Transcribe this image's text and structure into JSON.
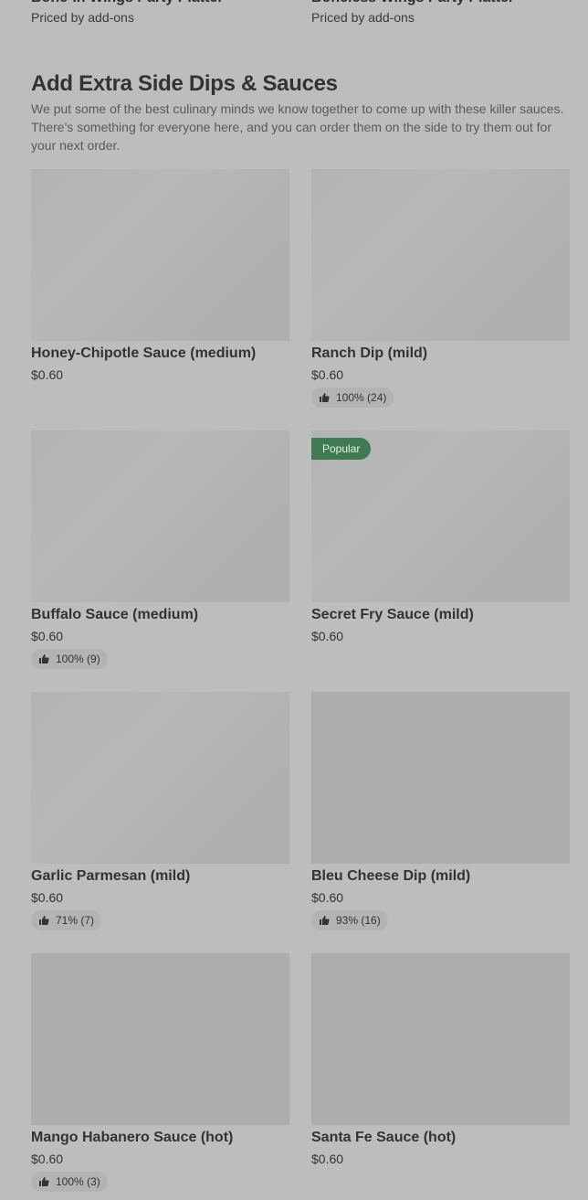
{
  "top_cards": [
    {
      "name": "Bone-In Wings Party Platter",
      "price_note": "Priced by add-ons"
    },
    {
      "name": "Boneless Wings Party Platter",
      "price_note": "Priced by add-ons"
    }
  ],
  "section": {
    "title": "Add Extra Side Dips & Sauces",
    "description": "We put some of the best culinary minds we know together to come up with these killer sauces. There's something for everyone here, and you can order them on the side to try them out for your next order."
  },
  "items": [
    {
      "title": "Honey-Chipotle Sauce (medium)",
      "price": "$0.60",
      "rating": "",
      "badge": ""
    },
    {
      "title": "Ranch Dip (mild)",
      "price": "$0.60",
      "rating": "100% (24)",
      "badge": ""
    },
    {
      "title": "Buffalo Sauce (medium)",
      "price": "$0.60",
      "rating": "100% (9)",
      "badge": ""
    },
    {
      "title": "Secret Fry Sauce (mild)",
      "price": "$0.60",
      "rating": "",
      "badge": "Popular"
    },
    {
      "title": "Garlic Parmesan (mild)",
      "price": "$0.60",
      "rating": "71% (7)",
      "badge": ""
    },
    {
      "title": "Bleu Cheese Dip (mild)",
      "price": "$0.60",
      "rating": "93% (16)",
      "badge": ""
    },
    {
      "title": "Mango Habanero Sauce (hot)",
      "price": "$0.60",
      "rating": "100% (3)",
      "badge": ""
    },
    {
      "title": "Santa Fe Sauce (hot)",
      "price": "$0.60",
      "rating": "",
      "badge": ""
    }
  ],
  "icons": {
    "rating": "thumbs-up-icon"
  },
  "colors": {
    "overlay_background": "#bdbdbd",
    "badge_background": "#3f7a52"
  }
}
